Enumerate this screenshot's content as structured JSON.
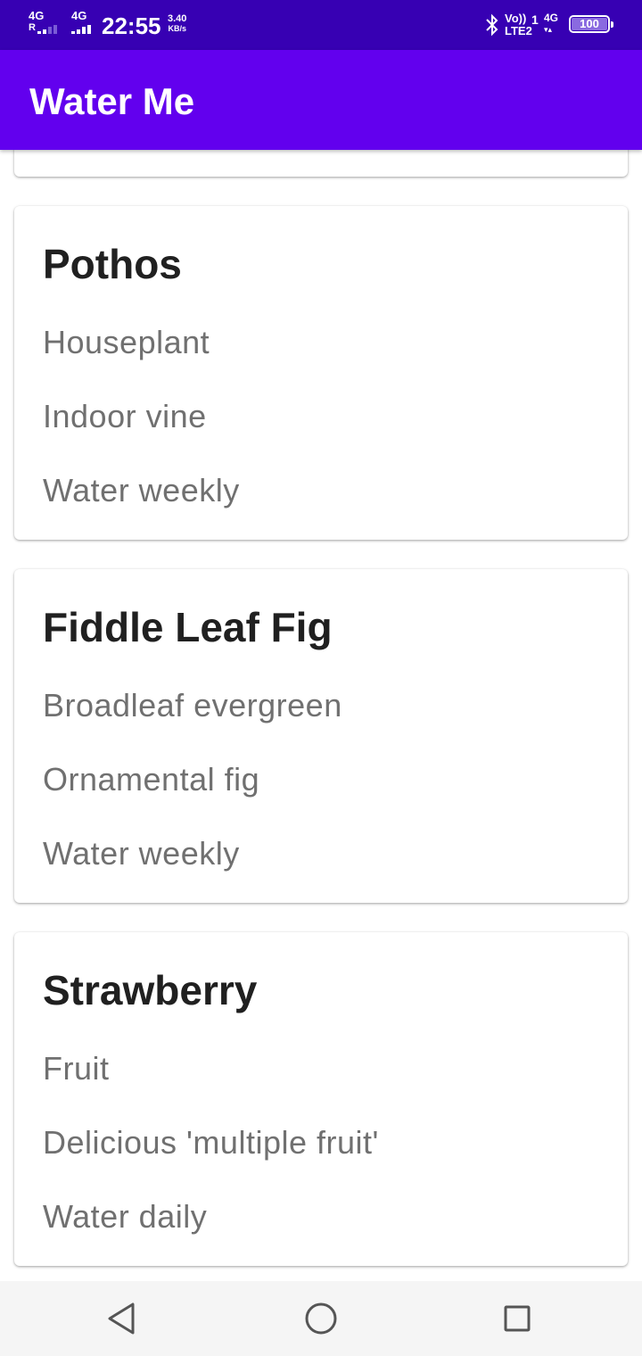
{
  "status_bar": {
    "network1": "4G",
    "network1_sub": "R",
    "network2": "4G",
    "time": "22:55",
    "speed_value": "3.40",
    "speed_unit": "KB/s",
    "volte_top": "Vo))",
    "volte_bottom": "LTE2",
    "sim_slot": "1",
    "network3": "4G",
    "battery": "100",
    "colors": {
      "background": "#3700b3"
    }
  },
  "app_bar": {
    "title": "Water Me",
    "colors": {
      "background": "#6200ee",
      "text": "#ffffff"
    }
  },
  "plants": [
    {
      "name": "Pothos",
      "type": "Houseplant",
      "description": "Indoor vine",
      "schedule": "Water weekly"
    },
    {
      "name": "Fiddle Leaf Fig",
      "type": "Broadleaf evergreen",
      "description": "Ornamental fig",
      "schedule": "Water weekly"
    },
    {
      "name": "Strawberry",
      "type": "Fruit",
      "description": "Delicious 'multiple fruit'",
      "schedule": "Water daily"
    }
  ],
  "nav_bar": {
    "icons": [
      "back-triangle-icon",
      "home-circle-icon",
      "recents-square-icon"
    ]
  }
}
